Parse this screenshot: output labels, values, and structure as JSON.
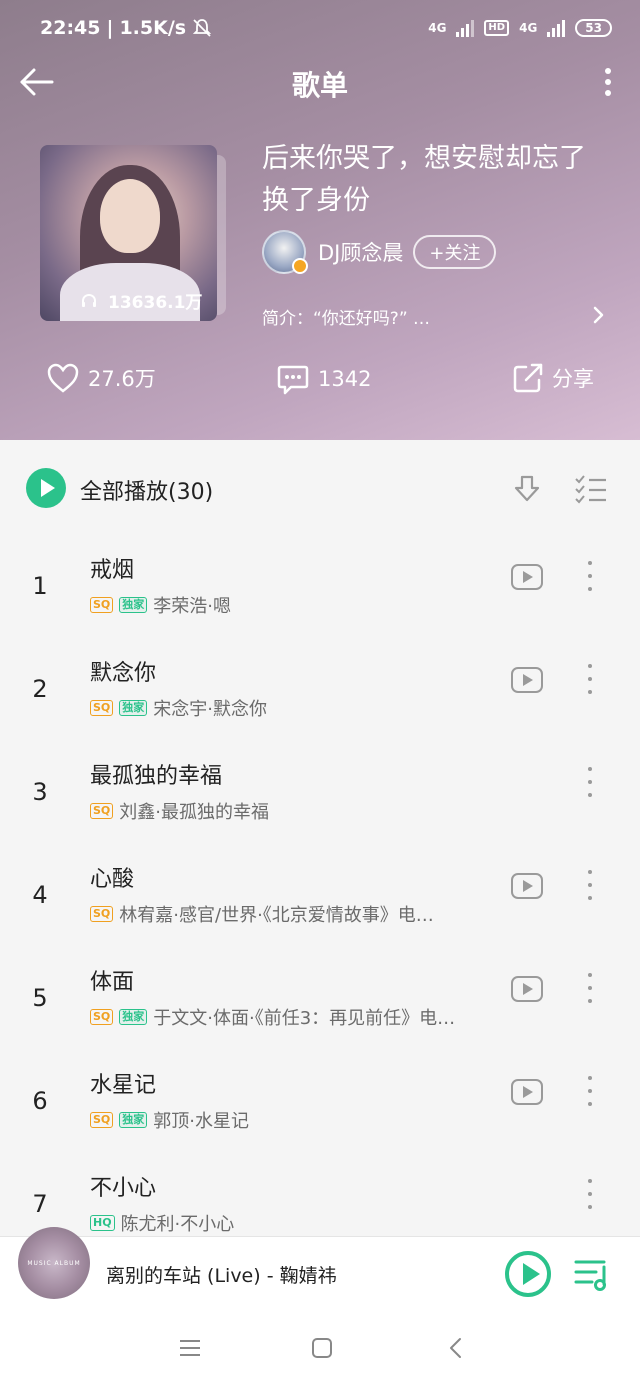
{
  "status_bar": {
    "time": "22:45",
    "speed": "1.5K/s",
    "net1": "4G",
    "hd": "HD",
    "net2": "4G",
    "battery": "53"
  },
  "nav": {
    "title": "歌单"
  },
  "playlist": {
    "title": "后来你哭了，想安慰却忘了换了身份",
    "play_count": "13636.1万",
    "creator": "DJ顾念晨",
    "follow_label": "+关注",
    "intro": "简介：“你还好吗?” …"
  },
  "actions": {
    "likes": "27.6万",
    "comments": "1342",
    "share": "分享"
  },
  "play_all": {
    "label": "全部播放(30)"
  },
  "songs": [
    {
      "index": "1",
      "title": "戒烟",
      "tags": [
        "SQ",
        "独家"
      ],
      "subtitle": "李荣浩·嗯",
      "video": true
    },
    {
      "index": "2",
      "title": "默念你",
      "tags": [
        "SQ",
        "独家"
      ],
      "subtitle": "宋念宇·默念你",
      "video": true
    },
    {
      "index": "3",
      "title": "最孤独的幸福",
      "tags": [
        "SQ"
      ],
      "subtitle": "刘鑫·最孤独的幸福",
      "video": false
    },
    {
      "index": "4",
      "title": "心酸",
      "tags": [
        "SQ"
      ],
      "subtitle": "林宥嘉·感官/世界·《北京爱情故事》电…",
      "video": true
    },
    {
      "index": "5",
      "title": "体面",
      "tags": [
        "SQ",
        "独家"
      ],
      "subtitle": "于文文·体面·《前任3：再见前任》电…",
      "video": true
    },
    {
      "index": "6",
      "title": "水星记",
      "tags": [
        "SQ",
        "独家"
      ],
      "subtitle": "郭顶·水星记",
      "video": true
    },
    {
      "index": "7",
      "title": "不小心",
      "tags": [
        "HQ"
      ],
      "subtitle": "陈尤利·不小心",
      "video": false
    }
  ],
  "mini_player": {
    "cover_text": "MUSIC ALBUM",
    "now_playing": "离别的车站 (Live) - 鞠婧祎"
  },
  "colors": {
    "accent": "#2bc28b",
    "sq_tag": "#f0a020",
    "header_gradient_start": "#8e7d8c",
    "header_gradient_end": "#d7bdd3"
  },
  "icons": {
    "back": "back-arrow-icon",
    "more": "more-vertical-icon",
    "headphones": "headphones-icon",
    "like": "heart-icon",
    "comment": "comment-icon",
    "share": "share-icon",
    "download": "download-icon",
    "multiselect": "multiselect-icon",
    "video": "video-play-icon",
    "playlist_queue": "playlist-queue-icon"
  }
}
